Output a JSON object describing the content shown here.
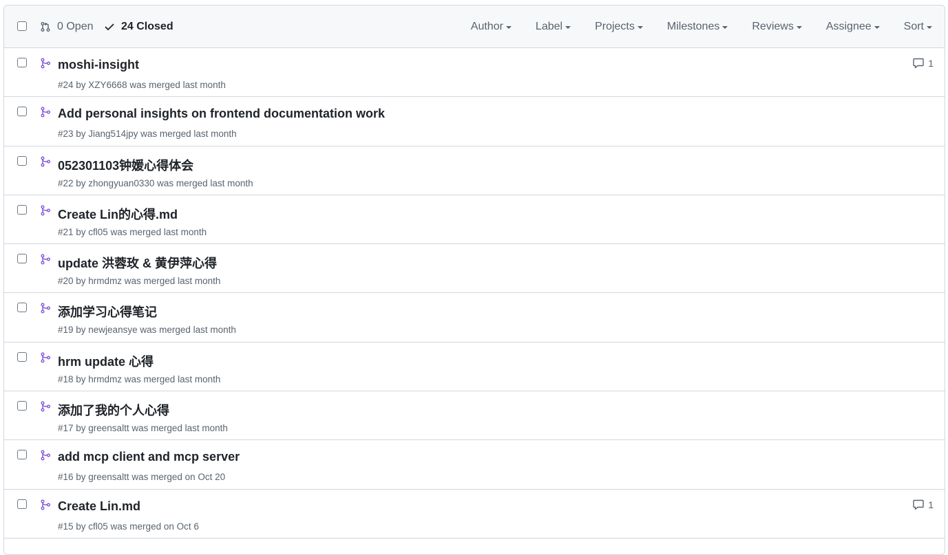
{
  "header": {
    "open_label": "0 Open",
    "closed_label": "24 Closed",
    "filters": [
      "Author",
      "Label",
      "Projects",
      "Milestones",
      "Reviews",
      "Assignee",
      "Sort"
    ]
  },
  "colors": {
    "merged": "#8250df",
    "border": "#d0d7de",
    "header_bg": "#f6f8fa",
    "muted": "#59636e"
  },
  "pull_requests": [
    {
      "title": "moshi-insight",
      "meta": "#24 by XZY6668 was merged last month",
      "comments": "1"
    },
    {
      "title": "Add personal insights on frontend documentation work",
      "meta": "#23 by Jiang514jpy was merged last month",
      "comments": ""
    },
    {
      "title": "052301103钟媛心得体会",
      "meta": "#22 by zhongyuan0330 was merged last month",
      "comments": ""
    },
    {
      "title": "Create Lin的心得.md",
      "meta": "#21 by cfl05 was merged last month",
      "comments": ""
    },
    {
      "title": "update 洪蓉玫 & 黄伊萍心得",
      "meta": "#20 by hrmdmz was merged last month",
      "comments": ""
    },
    {
      "title": "添加学习心得笔记",
      "meta": "#19 by newjeansye was merged last month",
      "comments": ""
    },
    {
      "title": "hrm update 心得",
      "meta": "#18 by hrmdmz was merged last month",
      "comments": ""
    },
    {
      "title": "添加了我的个人心得",
      "meta": "#17 by greensaltt was merged last month",
      "comments": ""
    },
    {
      "title": "add mcp client and mcp server",
      "meta": "#16 by greensaltt was merged on Oct 20",
      "comments": ""
    },
    {
      "title": "Create Lin.md",
      "meta": "#15 by cfl05 was merged on Oct 6",
      "comments": "1"
    }
  ]
}
